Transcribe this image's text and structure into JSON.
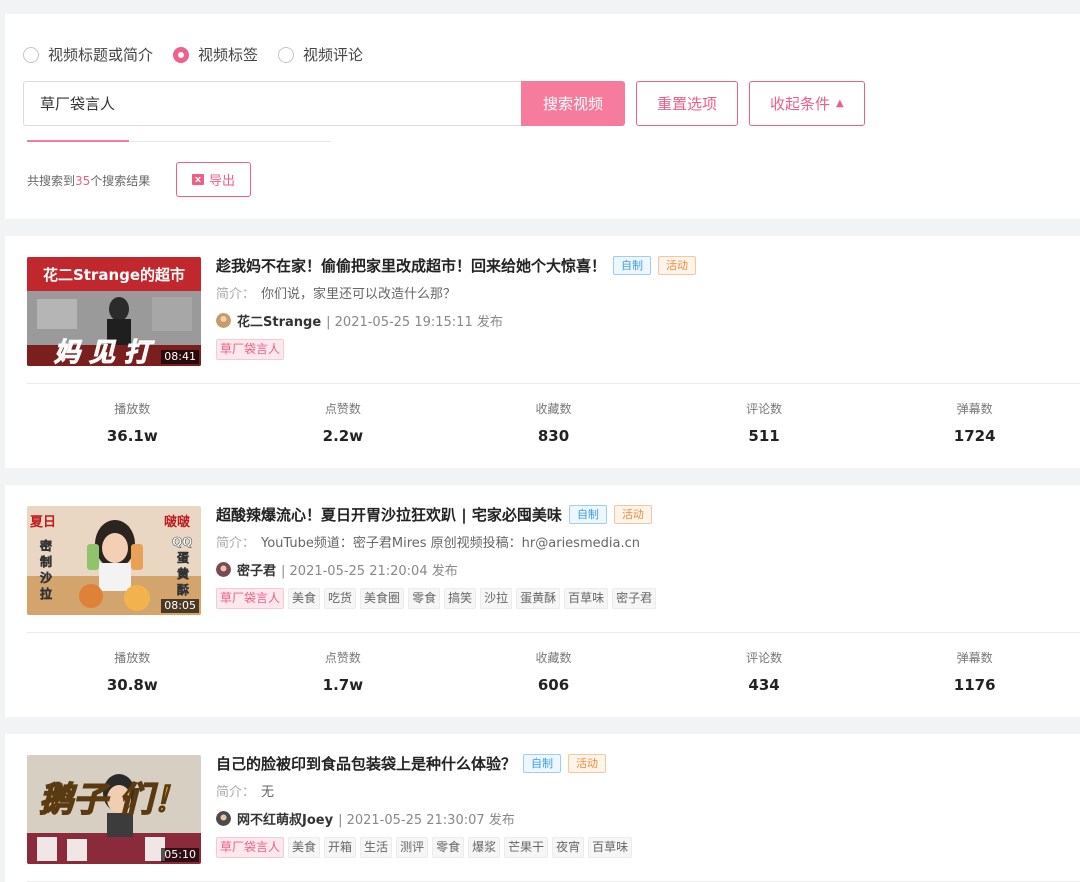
{
  "search": {
    "options": [
      {
        "label": "视频标题或简介",
        "checked": false
      },
      {
        "label": "视频标签",
        "checked": true
      },
      {
        "label": "视频评论",
        "checked": false
      }
    ],
    "query": "草厂袋言人",
    "search_button": "搜索视频",
    "reset_button": "重置选项",
    "collapse_button": "收起条件",
    "result_prefix": "共搜索到",
    "result_count": "35",
    "result_suffix": "个搜索结果",
    "export_button": "导出"
  },
  "stat_labels": [
    "播放数",
    "点赞数",
    "收藏数",
    "评论数",
    "弹幕数"
  ],
  "desc_label": "简介：",
  "videos": [
    {
      "title": "趁我妈不在家！偷偷把家里改成超市！回来给她个大惊喜！",
      "badges": [
        "自制",
        "活动"
      ],
      "desc": "你们说，家里还可以改造什么那？",
      "author": "花二Strange",
      "published": "| 2021-05-25 19:15:11 发布",
      "tags": [
        "草厂袋言人"
      ],
      "duration": "08:41",
      "thumb_text": {
        "top": "花二Strange的超市",
        "bottom": "妈 见 打"
      },
      "stats": [
        "36.1w",
        "2.2w",
        "830",
        "511",
        "1724"
      ]
    },
    {
      "title": "超酸辣爆流心！夏日开胃沙拉狂欢趴 | 宅家必囤美味",
      "badges": [
        "自制",
        "活动"
      ],
      "desc": "YouTube频道：密子君Mires 原创视频投稿：hr@ariesmedia.cn",
      "author": "密子君",
      "published": "| 2021-05-25 21:20:04 发布",
      "tags": [
        "草厂袋言人",
        "美食",
        "吃货",
        "美食圈",
        "零食",
        "搞笑",
        "沙拉",
        "蛋黄酥",
        "百草味",
        "密子君"
      ],
      "duration": "08:05",
      "thumb_text": {
        "left": "夏日密制沙拉",
        "right": "啵啵QQ蛋黄酥"
      },
      "stats": [
        "30.8w",
        "1.7w",
        "606",
        "434",
        "1176"
      ]
    },
    {
      "title": "自己的脸被印到食品包装袋上是种什么体验？",
      "badges": [
        "自制",
        "活动"
      ],
      "desc": "无",
      "author": "网不红萌叔Joey",
      "published": "| 2021-05-25 21:30:07 发布",
      "tags": [
        "草厂袋言人",
        "美食",
        "开箱",
        "生活",
        "测评",
        "零食",
        "爆浆",
        "芒果干",
        "夜宵",
        "百草味"
      ],
      "duration": "05:10",
      "thumb_text": {
        "main": "鹅子 们！"
      }
    }
  ],
  "colors": {
    "accent": "#f57c9d",
    "accent_text": "#ee5f86",
    "badge_blue": "#3b9ee6",
    "badge_orange": "#f08b3c"
  }
}
